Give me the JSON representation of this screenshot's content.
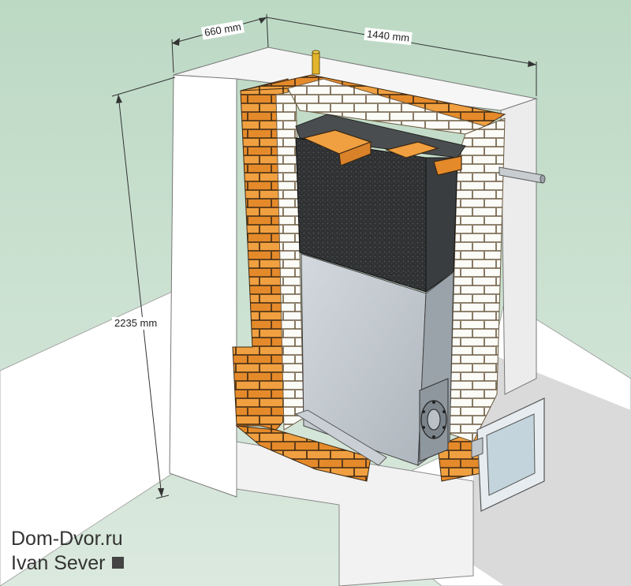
{
  "dimensions": {
    "depth": "660 mm",
    "width": "1440 mm",
    "height": "2235 mm"
  },
  "credits": {
    "site": "Dom-Dvor.ru",
    "author": "Ivan Sever"
  },
  "colors": {
    "ground": "#cfe3d4",
    "wall_white": "#ffffff",
    "red_brick": "#e48a2e",
    "mortar": "#3a2a18",
    "white_brick": "#f7f7f2",
    "insulation": "#2f3132",
    "steel": "#bcc4cb",
    "shadow": "#d6d6d6"
  },
  "icons": [
    "chimney-pipe-icon",
    "water-pipe-icon",
    "firebox-door-icon"
  ]
}
